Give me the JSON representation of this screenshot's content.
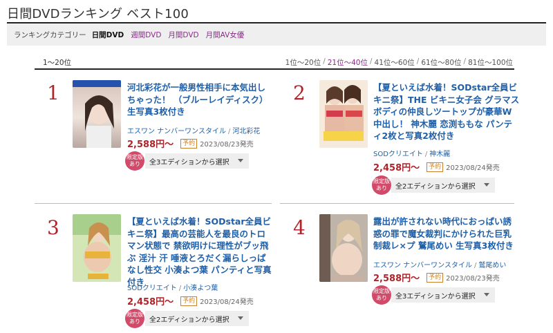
{
  "page_title": "日間DVDランキング ベスト100",
  "category_bar": {
    "label": "ランキングカテゴリー",
    "current": "日間DVD",
    "links": [
      "週間DVD",
      "月間DVD",
      "月間AV女優"
    ]
  },
  "range_current": "1〜20位",
  "pager": [
    "1位〜20位",
    "21位〜40位",
    "41位〜60位",
    "61位〜80位",
    "81位〜100位"
  ],
  "pager_separator": "/",
  "maker_separator": "/",
  "items": [
    {
      "rank": "1",
      "title": "河北彩花が一般男性相手に本気出しちゃった！ （ブルーレイディスク） 生写真3枚付き",
      "maker": "エスワン ナンバーワンスタイル",
      "actress": "河北彩花",
      "price": "2,588円〜",
      "preorder": "予約",
      "release": "2023/08/23発売",
      "limited": "限定版あり",
      "edition": "全3エディションから選択"
    },
    {
      "rank": "2",
      "title": "【夏といえば水着！SODstar全員ビキニ祭】THE ビキニ女子会 グラマスボディの仲良しツートップが豪華W中出し！ 神木麗 恋渕ももな パンティ2枚と写真2枚付き",
      "maker": "SODクリエイト",
      "actress": "神木麗",
      "price": "2,458円〜",
      "preorder": "予約",
      "release": "2023/08/24発売",
      "limited": "限定版あり",
      "edition": "全2エディションから選択"
    },
    {
      "rank": "3",
      "title": "【夏といえば水着！SODstar全員ビキニ祭】最高の芸能人を最良のトロマン状態で 禁欲明けに理性がブッ飛ぶ 淫汁 汗 唾液とろだく漏らしっぱなし性交 小湊よつ葉 パンティと写真付き",
      "maker": "SODクリエイト",
      "actress": "小湊よつ葉",
      "price": "2,458円〜",
      "preorder": "予約",
      "release": "2023/08/24発売",
      "limited": "限定版あり",
      "edition": "全2エディションから選択"
    },
    {
      "rank": "4",
      "title": "露出が許されない時代におっぱい誘惑の罪で魔女裁判にかけられた巨乳制裁レ×プ 鷲尾めい 生写真3枚付き",
      "maker": "エスワン ナンバーワンスタイル",
      "actress": "鷲尾めい",
      "price": "2,588円〜",
      "preorder": "予約",
      "release": "2023/08/23発売",
      "limited": "限定版あり",
      "edition": "全3エディションから選択"
    }
  ]
}
